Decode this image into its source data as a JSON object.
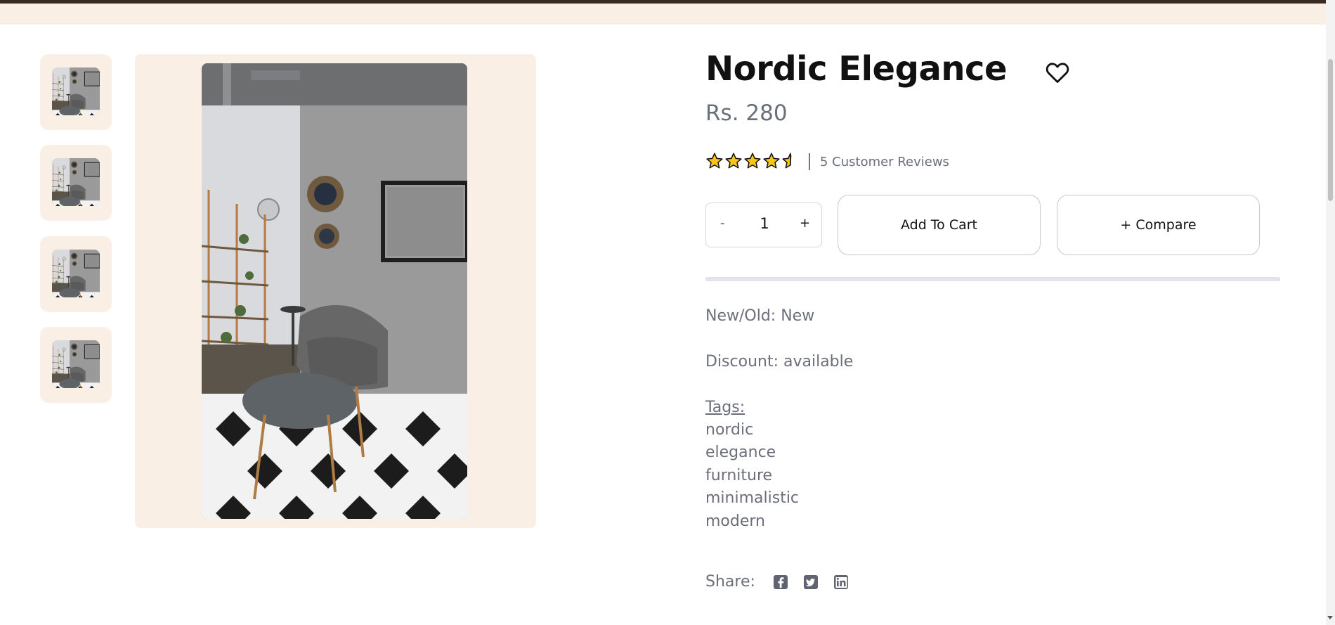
{
  "product": {
    "title": "Nordic Elegance",
    "price": "Rs. 280",
    "rating": 4.5,
    "rating_max": 5,
    "reviews_label": "5 Customer Reviews"
  },
  "thumbnails": [
    {
      "icon": "room-photo-thumbnail"
    },
    {
      "icon": "room-photo-thumbnail"
    },
    {
      "icon": "room-photo-thumbnail"
    },
    {
      "icon": "room-photo-thumbnail"
    }
  ],
  "cart": {
    "minus_label": "-",
    "quantity": "1",
    "plus_label": "+",
    "add_to_cart_label": "Add To Cart",
    "compare_label": "+ Compare"
  },
  "details": {
    "condition_label": "New/Old: New",
    "discount_label": "Discount: available",
    "tags_label": "Tags:",
    "tags": [
      "nordic",
      "elegance",
      "furniture",
      "minimalistic",
      "modern"
    ]
  },
  "share": {
    "label": "Share:",
    "networks": [
      "facebook-icon",
      "twitter-icon",
      "linkedin-icon"
    ]
  },
  "colors": {
    "accent_band": "#f9efe5",
    "top_bar": "#3a2a20",
    "star": "#f5c518",
    "muted_text": "#6b6f7a"
  }
}
